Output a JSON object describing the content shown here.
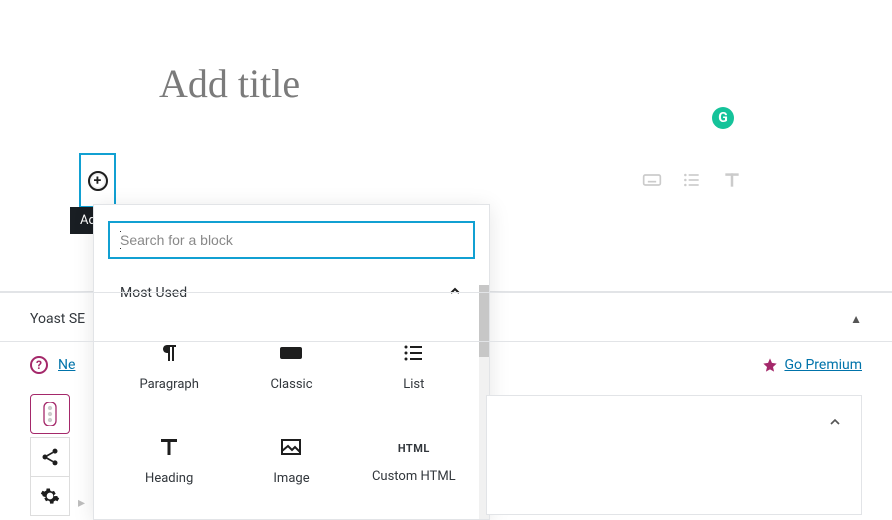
{
  "editor": {
    "title_placeholder": "Add title",
    "add_block_tooltip": "Add block",
    "grammarly_letter": "G"
  },
  "inserter": {
    "search_placeholder": "Search for a block",
    "section_label": "Most Used",
    "blocks": [
      {
        "id": "paragraph",
        "label": "Paragraph"
      },
      {
        "id": "classic",
        "label": "Classic"
      },
      {
        "id": "list",
        "label": "List"
      },
      {
        "id": "heading",
        "label": "Heading"
      },
      {
        "id": "image",
        "label": "Image"
      },
      {
        "id": "custom-html",
        "label": "Custom HTML",
        "icon_text": "HTML"
      }
    ]
  },
  "yoast": {
    "panel_title_partial": "Yoast SE",
    "need_help_partial": "Ne",
    "go_premium": "Go Premium"
  }
}
